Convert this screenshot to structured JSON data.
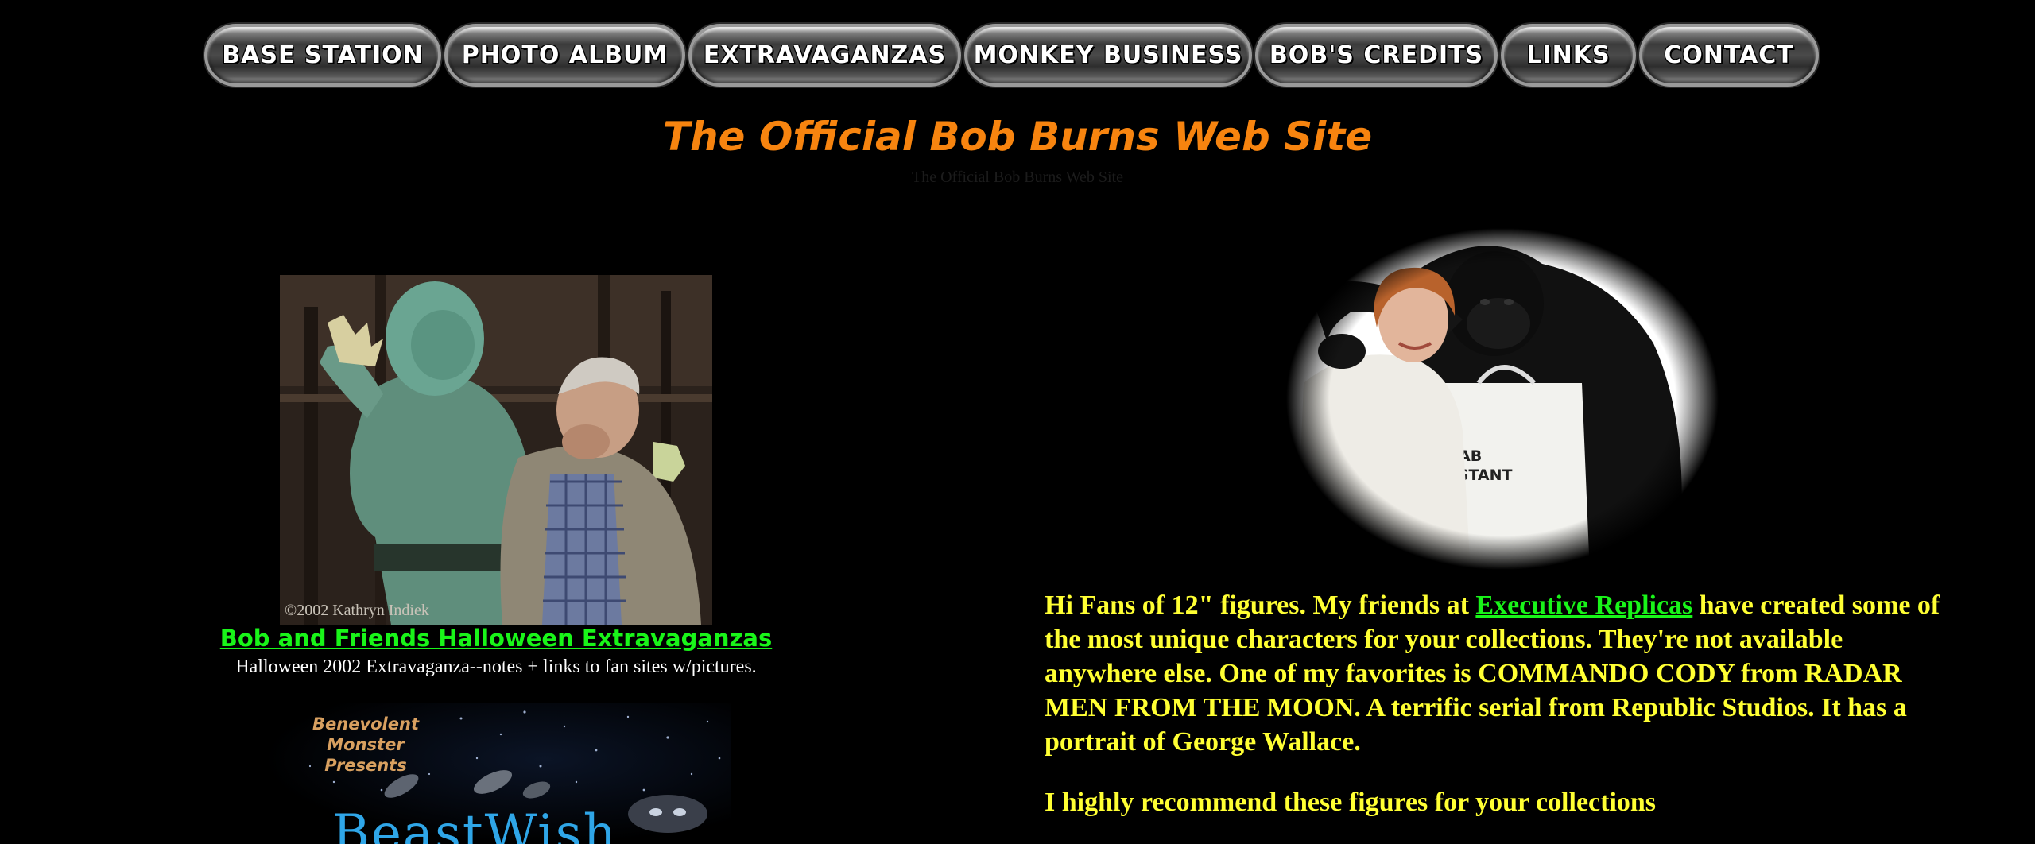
{
  "nav": {
    "items": [
      {
        "label": "BASE STATION"
      },
      {
        "label": "PHOTO ALBUM"
      },
      {
        "label": "EXTRAVAGANZAS"
      },
      {
        "label": "MONKEY BUSINESS"
      },
      {
        "label": "BOB'S CREDITS"
      },
      {
        "label": "LINKS"
      },
      {
        "label": "CONTACT"
      }
    ]
  },
  "header": {
    "title": "The Official Bob Burns Web Site",
    "subtitle": "The Official Bob Burns Web Site"
  },
  "left": {
    "photo_credit": "©2002 Kathryn Indiek",
    "extravaganza_link": "Bob and Friends Halloween Extravaganzas",
    "extravaganza_desc": "Halloween 2002 Extravaganza--notes + links to fan sites w/pictures.",
    "banner": {
      "presents_line1": "Benevolent Monster",
      "presents_line2": "Presents",
      "title": "BeastWish"
    }
  },
  "right": {
    "apron_text_line1": "LAB",
    "apron_text_line2": "SISTANT",
    "fans_text_before": "Hi Fans of 12\" figures. My friends at ",
    "fans_link": "Executive Replicas",
    "fans_text_after": " have created some of the most unique characters for your collections. They're not available anywhere else. One of my favorites is COMMANDO CODY from RADAR MEN FROM THE MOON. A terrific serial from Republic Studios. It has a portrait of George Wallace.",
    "recommend": "I highly recommend these figures for your collections"
  },
  "colors": {
    "background": "#000000",
    "title": "#f7840f",
    "link": "#19f519",
    "body_text": "#ffff33"
  }
}
